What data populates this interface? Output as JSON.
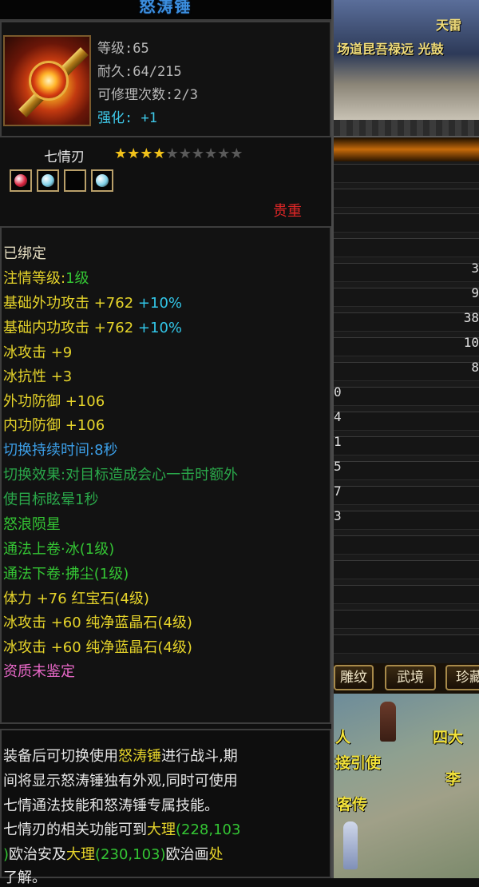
{
  "item": {
    "name": "怒涛锤",
    "level": "等级:65",
    "durability": "耐久:64/215",
    "repairs": "可修理次数:2/3",
    "strength_label": "强化:",
    "strength_value": "+1"
  },
  "gem_row": {
    "label": "七情刃",
    "stars_filled": 4,
    "stars_total": 10,
    "slots": [
      {
        "gem": "red-gem-icon",
        "color": "#d8203c"
      },
      {
        "gem": "crystal-gem-icon",
        "color": "#7ed0e8"
      },
      {
        "gem": "empty-slot",
        "color": "#050505"
      },
      {
        "gem": "crystal-gem-icon",
        "color": "#7ed0e8"
      }
    ],
    "rarity": "贵重"
  },
  "stats": {
    "bound": "已绑定",
    "infuse_label": "注情等级:",
    "infuse_value": "1级",
    "ext_attack": "基础外功攻击 +762",
    "ext_attack_pct": "+10%",
    "int_attack": "基础内功攻击 +762",
    "int_attack_pct": "+10%",
    "ice_attack": "冰攻击 +9",
    "ice_resist": "冰抗性 +3",
    "ext_defense": "外功防御 +106",
    "int_defense": "内功防御 +106",
    "switch_duration": "切换持续时间:8秒",
    "switch_effect_1": "切换效果:对目标造成会心一击时额外",
    "switch_effect_2": "使目标眩晕1秒",
    "skill_name": "怒浪陨星",
    "skill_book_1": "通法上卷·冰(1级)",
    "skill_book_2": "通法下卷·拂尘(1级)",
    "gem_stat_1": "体力 +76 红宝石(4级)",
    "gem_stat_2": "冰攻击 +60 纯净蓝晶石(4级)",
    "gem_stat_3": "冰攻击 +60 纯净蓝晶石(4级)",
    "aptitude": "资质未鉴定"
  },
  "description": {
    "l1a": "装备后可切换使用",
    "l1b": "怒涛锤",
    "l1c": "进行战斗,期",
    "l2": "间将显示怒涛锤独有外观,同时可使用",
    "l3": "七情通法技能和怒涛锤专属技能。",
    "l4a": "七情刃的相关功能可到",
    "l4b": "大理",
    "l4c": "(228,103",
    "l5a": ")",
    "l5b": "欧治安及",
    "l5c": "大理",
    "l5d": "(230,103)",
    "l5e": "欧治画",
    "l5f": "处",
    "l6": "了解。"
  },
  "scene": {
    "banner_text": "场道昆吾禄远 光鼓",
    "banner_top": "天雷",
    "list_numbers": [
      "3",
      "9",
      "38",
      "10",
      "8",
      "0",
      "4",
      "1",
      "5",
      "7",
      "3"
    ],
    "tabs": [
      "雕纹",
      "武境",
      "珍藏"
    ],
    "npc_labels": [
      "人",
      "四大",
      "接引使",
      "李",
      "客传"
    ]
  },
  "colors": {
    "title": "#3c8fe0",
    "rarity": "#e02626",
    "highlight": "#e6d42a",
    "green": "#34c534",
    "cyan": "#32c6e8"
  }
}
